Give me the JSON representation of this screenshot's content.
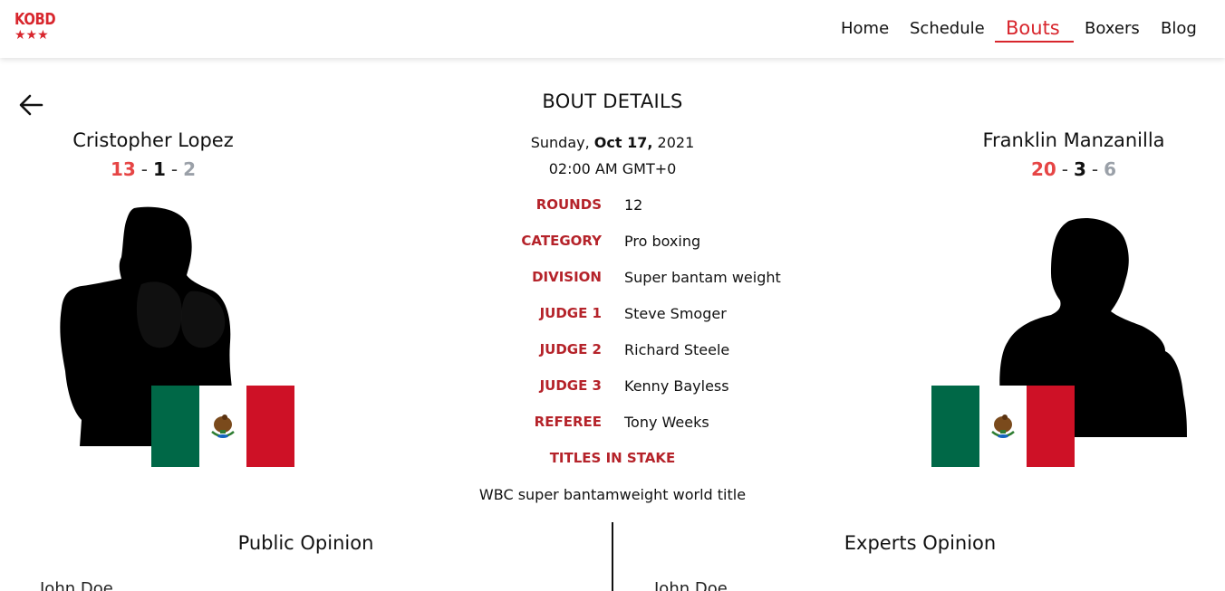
{
  "brand": {
    "logo_text": "KOBD",
    "logo_stars": "★★★"
  },
  "nav": {
    "items": [
      "Home",
      "Schedule",
      "Bouts",
      "Boxers",
      "Blog"
    ],
    "active": "Bouts"
  },
  "page": {
    "title": "BOUT DETAILS"
  },
  "bout": {
    "weekday": "Sunday,",
    "date": "Oct 17,",
    "year": "2021",
    "time": "02:00 AM GMT+0",
    "details": [
      {
        "label": "ROUNDS",
        "value": "12"
      },
      {
        "label": "CATEGORY",
        "value": "Pro boxing"
      },
      {
        "label": "DIVISION",
        "value": "Super bantam weight"
      },
      {
        "label": "JUDGE 1",
        "value": "Steve Smoger"
      },
      {
        "label": "JUDGE 2",
        "value": "Richard Steele"
      },
      {
        "label": "JUDGE 3",
        "value": "Kenny Bayless"
      },
      {
        "label": "REFEREE",
        "value": "Tony Weeks"
      }
    ],
    "titles_label": "TITLES IN STAKE",
    "titles_value": "WBC super bantamweight world title"
  },
  "fighters": {
    "left": {
      "name": "Cristopher Lopez",
      "wins": "13",
      "losses": "1",
      "draws": "2",
      "sep": "-"
    },
    "right": {
      "name": "Franklin Manzanilla",
      "wins": "20",
      "losses": "3",
      "draws": "6",
      "sep": "-"
    }
  },
  "opinions": {
    "public": {
      "title": "Public Opinion",
      "first_user": "John Doe"
    },
    "experts": {
      "title": "Experts Opinion",
      "first_user": "John Doe"
    }
  },
  "colors": {
    "accent": "#d8262d",
    "label_red": "#b5232a",
    "win_red": "#e64545",
    "draw_grey": "#9aa0a8",
    "flag_green": "#006847",
    "flag_red": "#ce1126"
  }
}
